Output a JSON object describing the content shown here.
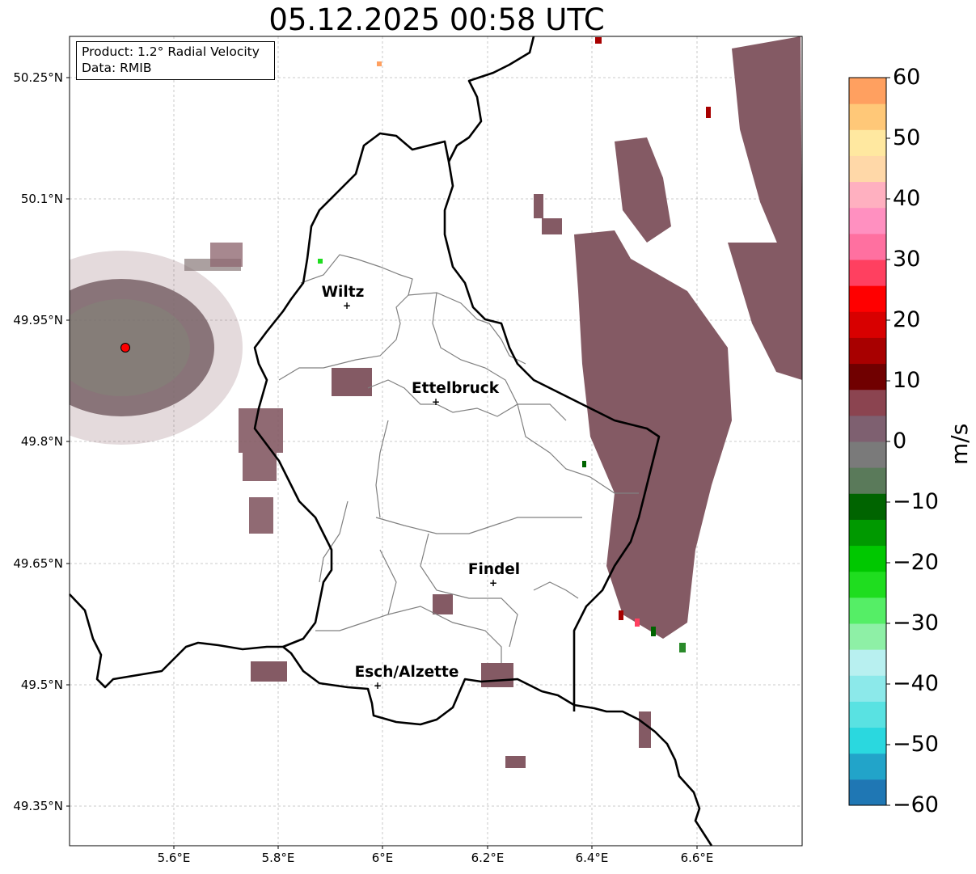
{
  "title": "05.12.2025 00:58 UTC",
  "info": {
    "product": "Product: 1.2° Radial Velocity",
    "data": "Data: RMIB"
  },
  "map": {
    "lat_ticks": [
      "50.25°N",
      "50.1°N",
      "49.95°N",
      "49.8°N",
      "49.65°N",
      "49.5°N",
      "49.35°N"
    ],
    "lon_ticks": [
      "5.6°E",
      "5.8°E",
      "6°E",
      "6.2°E",
      "6.4°E",
      "6.6°E"
    ],
    "cities": [
      {
        "name": "Wiltz"
      },
      {
        "name": "Ettelbruck"
      },
      {
        "name": "Findel"
      },
      {
        "name": "Esch/Alzette"
      }
    ],
    "radar_site_icon": "red-dot-icon",
    "city_marker_icon": "plus-icon",
    "echo_color_dominant": "#845a64",
    "gridlines": true
  },
  "colorbar": {
    "unit": "m/s",
    "min": -60,
    "max": 60,
    "tick_labels": [
      "60",
      "50",
      "40",
      "30",
      "20",
      "10",
      "0",
      "−10",
      "−20",
      "−30",
      "−40",
      "−50",
      "−60"
    ],
    "colors": [
      "#1f77b4",
      "#22a4c9",
      "#2ad8df",
      "#59e2e2",
      "#8ce9ea",
      "#b8f0f0",
      "#8ef0a6",
      "#55ee66",
      "#1fdd1f",
      "#00c800",
      "#009900",
      "#006400",
      "#5a7a5a",
      "#7a7a7a",
      "#7e6070",
      "#8b4450",
      "#700000",
      "#a80000",
      "#d80000",
      "#ff0000",
      "#ff4060",
      "#ff70a0",
      "#ff90c0",
      "#ffb0c0",
      "#ffd8a8",
      "#ffe8a0",
      "#ffc878",
      "#ffa060"
    ]
  }
}
